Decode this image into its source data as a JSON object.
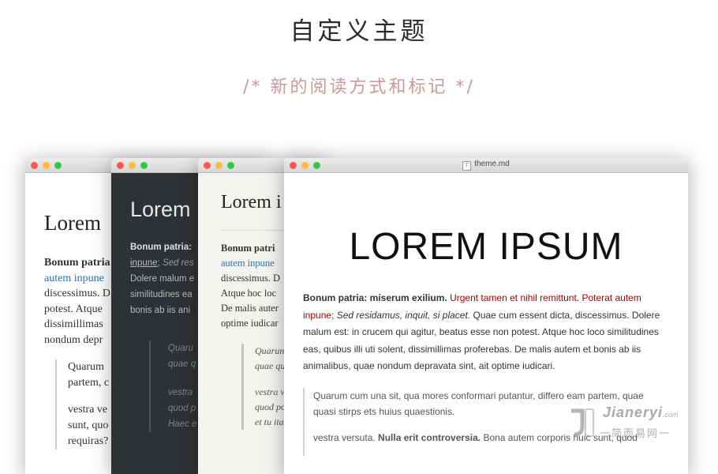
{
  "header": {
    "title": "自定义主题",
    "subtitle": "/* 新的阅读方式和标记 */"
  },
  "windows": {
    "w1": {
      "heading": "Lorem",
      "p_bold": "Bonum patria",
      "p_link": "autem inpune",
      "p_lines": [
        "discessimus. D",
        "potest. Atque",
        "dissimillimas",
        "nondum depr"
      ],
      "bq_lines": [
        "Quarum",
        "partem, c",
        "vestra ve",
        "sunt, quo",
        "requiras?"
      ]
    },
    "w2": {
      "heading": "Lorem",
      "p_bold": "Bonum patria:",
      "p_link": "inpune",
      "p_italic": "Sed res",
      "p_lines": [
        "Dolere malum e",
        "similitudines ea",
        "bonis ab iis ani"
      ],
      "bq_lines": [
        "Quaru",
        "quae q",
        "vestra",
        "quod p",
        "Haec e"
      ]
    },
    "w3": {
      "heading": "Lorem i",
      "p_bold": "Bonum patri",
      "p_link": "autem inpune",
      "p_lines": [
        "discessimus. D",
        "Atque hoc loc",
        "De malis auter",
        "optime iudicar"
      ],
      "bq_lines": [
        "Quarun",
        "quae qu",
        "vestra v",
        "quod po",
        "et tu ita"
      ]
    },
    "w4": {
      "doc_icon": "T",
      "file_name": "theme.md",
      "heading": "LOREM IPSUM",
      "p_bold": "Bonum patria: miserum exilium.",
      "p_red": "Urgent tamen et nihil remittunt. Poterat autem inpune",
      "p_italic": "Sed residamus, inquit, si placet.",
      "p_rest": "Quae cum essent dicta, discessimus. Dolere malum est: in crucem qui agitur, beatus esse non potest. Atque hoc loco similitudines eas, quibus illi uti solent, dissimillimas proferebas. De malis autem et bonis ab iis animalibus, quae nondum depravata sint, ait optime iudicari.",
      "bq1": "Quarum cum una sit, qua mores conformari putantur, differo eam partem, quae quasi stirps ets huius quaestionis.",
      "bq2_start": "vestra versuta.",
      "bq2_bold": "Nulla erit controversia.",
      "bq2_rest": "Bona autem corporis huic sunt, quod"
    }
  },
  "watermark": {
    "name": "Jianeryi",
    "suffix": ".com",
    "subtitle": "一简而易网一"
  },
  "colors": {
    "traffic_red": "#fc5753",
    "traffic_yellow": "#fdbc40",
    "traffic_green": "#33c748",
    "subtitle": "#c9999c",
    "link_red": "#a40000",
    "link_blue": "#2f6fb3"
  }
}
